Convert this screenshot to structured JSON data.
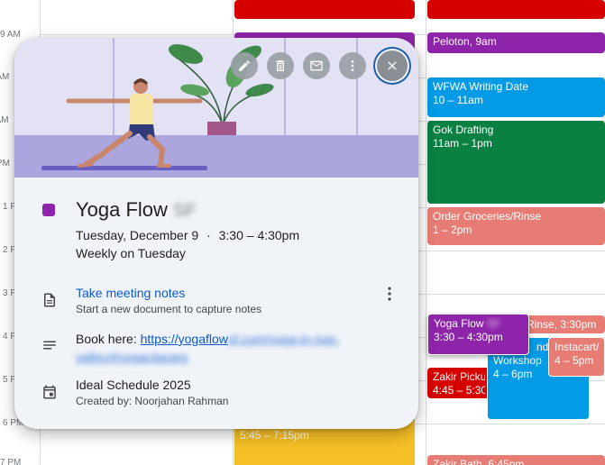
{
  "time_labels": [
    "9 AM",
    "10 AM",
    "11 AM",
    "12 PM",
    "1 PM",
    "2 PM",
    "3 PM",
    "4 PM",
    "5 PM",
    "6 PM",
    "7 PM"
  ],
  "events": {
    "peloton": {
      "title": "Peloton",
      "time": "9am",
      "color": "#8e24aa"
    },
    "wfwa": {
      "title": "WFWA Writing Date",
      "time": "10 – 11am",
      "color": "#039be5"
    },
    "gok": {
      "title": "Gok Drafting",
      "time": "11am – 1pm",
      "color": "#0b8043"
    },
    "groceries": {
      "title": "Order Groceries/Rinse",
      "time": "1 – 2pm",
      "color": "#e67c73"
    },
    "rinse": {
      "title": "Rinse",
      "time": "3:30pm",
      "color": "#e67c73"
    },
    "yoga_small": {
      "title": "Yoga Flow",
      "title_blurred": "SF",
      "time": "3:30 – 4:30pm",
      "color": "#8e24aa"
    },
    "workshop": {
      "title_a": "nd",
      "title_b": "Workshop",
      "time": "4 – 6pm",
      "color": "#039be5"
    },
    "instacart": {
      "title": "Instacart/",
      "time": "4 – 5pm",
      "color": "#e67c73"
    },
    "zakir_pickup": {
      "title": "Zakir Picku",
      "time": "4:45 – 5:30",
      "color": "#d50000"
    },
    "yellow": {
      "time": "5:45 – 7:15pm",
      "color": "#f6bf26"
    },
    "zakir_bath": {
      "title": "Zakir Bath",
      "time": "6:45pm",
      "color": "#e67c73"
    }
  },
  "popup": {
    "toolbar_icons": [
      "edit-icon",
      "delete-icon",
      "email-icon",
      "more-vert-icon",
      "close-icon"
    ],
    "event_color": "#8e24aa",
    "title": "Yoga Flow",
    "title_blurred": "SF",
    "date": "Tuesday, December 9",
    "separator": "·",
    "time": "3:30 – 4:30pm",
    "recurrence": "Weekly on Tuesday",
    "notes": {
      "link": "Take meeting notes",
      "sub": "Start a new document to capture notes"
    },
    "description": {
      "prefix": "Book here: ",
      "link_a": "https://yogaflow",
      "link_blur": "sf.com/yoga-in-noe-valley/#yogaclasses"
    },
    "calendar": {
      "name": "Ideal Schedule 2025",
      "created_by": "Created by: Noorjahan Rahman"
    }
  }
}
